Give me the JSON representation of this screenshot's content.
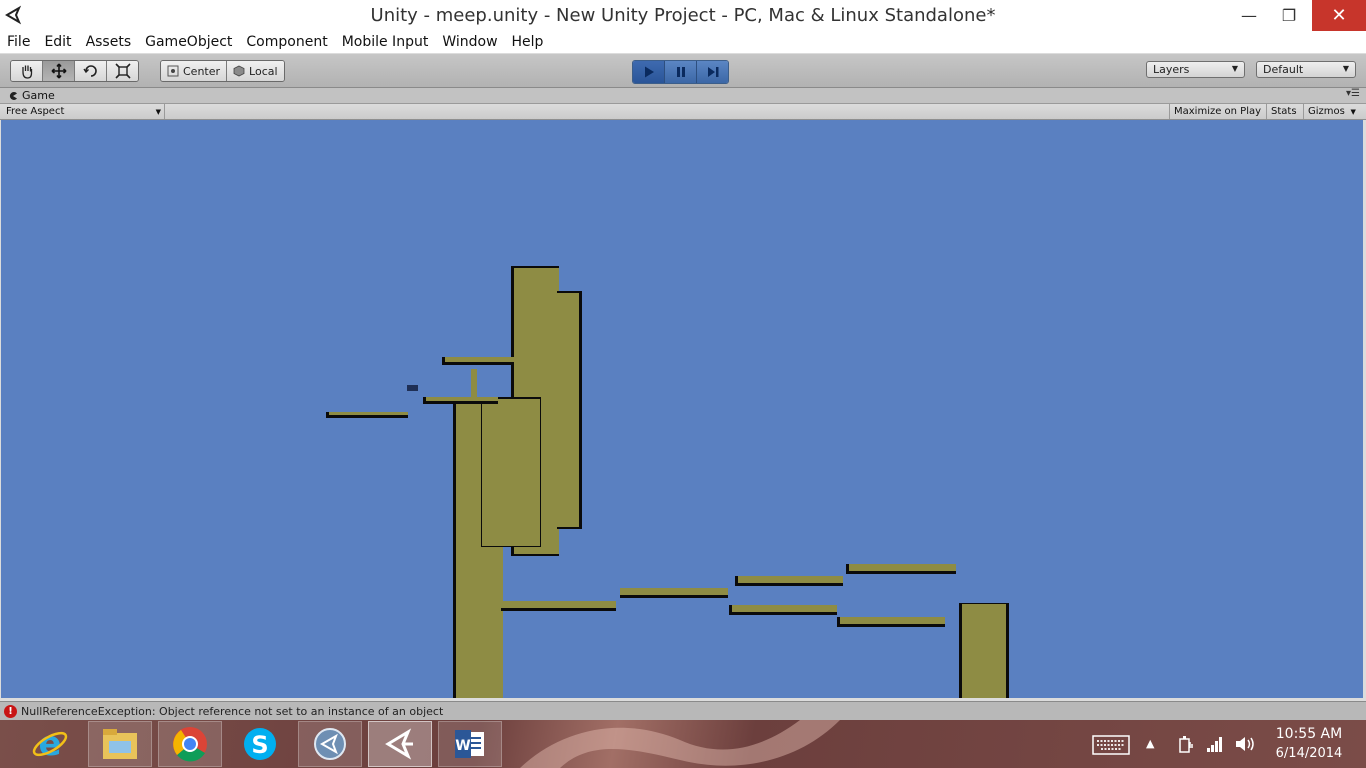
{
  "window": {
    "title": "Unity - meep.unity - New Unity Project - PC, Mac & Linux Standalone*",
    "min_glyph": "—",
    "max_glyph": "❐",
    "close_glyph": "✕"
  },
  "menu": [
    "File",
    "Edit",
    "Assets",
    "GameObject",
    "Component",
    "Mobile Input",
    "Window",
    "Help"
  ],
  "toolbar": {
    "pivot_center": "Center",
    "pivot_local": "Local",
    "layers": "Layers",
    "layout": "Default"
  },
  "game_panel": {
    "tab_label": "Game",
    "aspect": "Free Aspect",
    "maximize_on_play": "Maximize on Play",
    "stats": "Stats",
    "gizmos": "Gizmos"
  },
  "status": {
    "message": "NullReferenceException: Object reference not set to an instance of an object"
  },
  "taskbar": {
    "apps": [
      "internet-explorer",
      "file-explorer",
      "chrome",
      "skype",
      "remote-desktop",
      "unity",
      "word"
    ],
    "time": "10:55 AM",
    "date": "6/14/2014"
  },
  "colors": {
    "sky": "#5a80c1",
    "platform": "#8e8c44",
    "accent_play": "#3c67a6",
    "error": "#c81414"
  }
}
